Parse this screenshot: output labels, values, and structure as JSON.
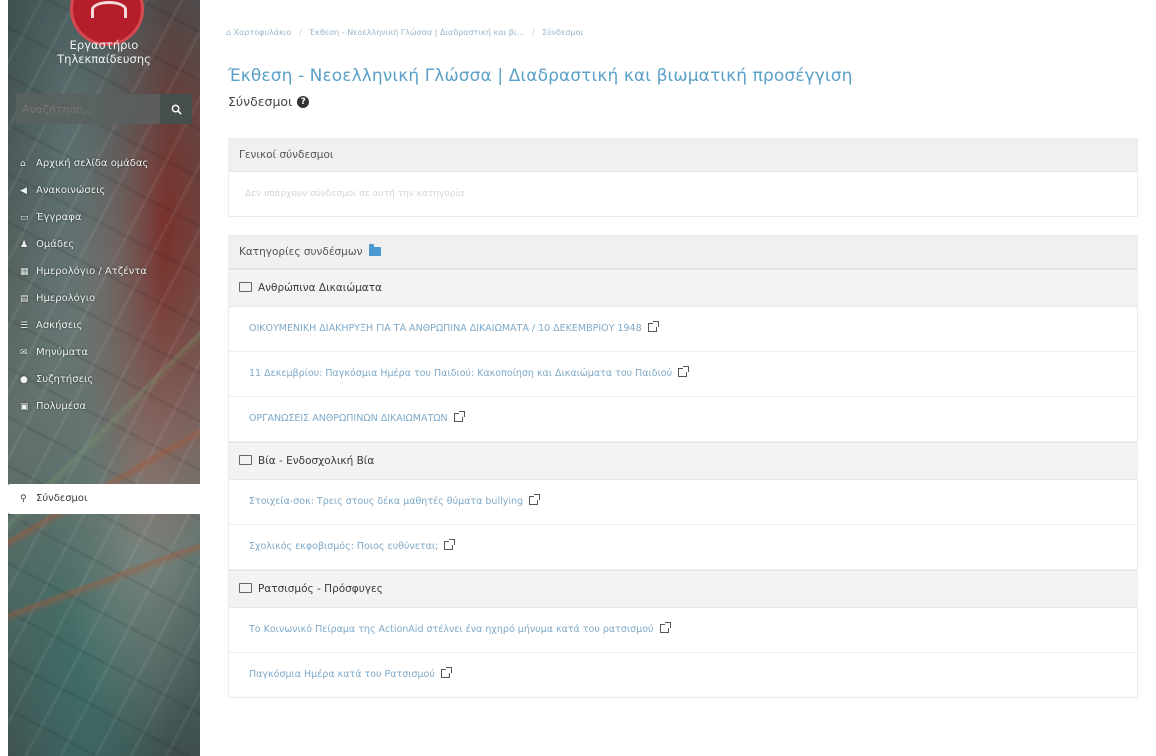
{
  "site": {
    "name_line1": "Εργαστήριο",
    "name_line2": "Τηλεκπαίδευσης"
  },
  "search": {
    "placeholder": "Αναζήτηση..."
  },
  "nav": {
    "items": [
      {
        "label": "Αρχική σελίδα ομάδας",
        "icon": "home-icon"
      },
      {
        "label": "Ανακοινώσεις",
        "icon": "bullhorn-icon"
      },
      {
        "label": "Έγγραφα",
        "icon": "folder-icon"
      },
      {
        "label": "Ομάδες",
        "icon": "users-icon"
      },
      {
        "label": "Ημερολόγιο / Ατζέντα",
        "icon": "calendar-icon"
      },
      {
        "label": "Ημερολόγιο",
        "icon": "calendar-alt-icon"
      },
      {
        "label": "Ασκήσεις",
        "icon": "tasks-icon"
      },
      {
        "label": "Μηνύματα",
        "icon": "envelope-icon"
      },
      {
        "label": "Συζητήσεις",
        "icon": "comments-icon"
      },
      {
        "label": "Πολυμέσα",
        "icon": "film-icon"
      }
    ],
    "active_label": "Σύνδεσμοι",
    "active_icon": "link-icon"
  },
  "breadcrumb": [
    "Χαρτοφυλάκιο",
    "Έκθεση - Νεοελληνική Γλώσσα | Διαδραστική και βι...",
    "Σύνδεσμοι"
  ],
  "page": {
    "title": "Έκθεση - Νεοελληνική Γλώσσα | Διαδραστική και βιωματική προσέγγιση",
    "subtitle": "Σύνδεσμοι"
  },
  "general_links": {
    "heading": "Γενικοί σύνδεσμοι",
    "empty_text": "Δεν υπάρχουν σύνδεσμοι σε αυτή την κατηγορία"
  },
  "categories_panel": {
    "heading": "Κατηγορίες συνδέσμων",
    "categories": [
      {
        "name": "Ανθρώπινα Δικαιώματα",
        "links": [
          "ΟΙΚΟΥΜΕΝΙΚΗ ΔΙΑΚΗΡΥΞΗ ΓΙΑ ΤΑ ΑΝΘΡΩΠΙΝΑ ΔΙΚΑΙΩΜΑΤΑ / 10 ΔΕΚΕΜΒΡΙΟΥ 1948",
          "11 Δεκεμβρίου: Παγκόσμια Ημέρα του Παιδιού: Κακοποίηση και Δικαιώματα του Παιδιού",
          "ΟΡΓΑΝΩΣΕΙΣ ΑΝΘΡΩΠΙΝΩΝ ΔΙΚΑΙΩΜΑΤΩΝ"
        ]
      },
      {
        "name": "Βία - Ενδοσχολική Βία",
        "links": [
          "Στοιχεία-σοκ: Τρεις στους δέκα μαθητές θύματα bullying",
          "Σχολικός εκφοβισμός: Ποιος ευθύνεται;"
        ]
      },
      {
        "name": "Ρατσισμός - Πρόσφυγες",
        "links": [
          "Το Κοινωνικό Πείραμα της ActionAid στέλνει ένα ηχηρό μήνυμα κατά του ρατσισμού",
          "Παγκόσμια Ημέρα κατά του Ρατσισμού"
        ]
      }
    ]
  }
}
